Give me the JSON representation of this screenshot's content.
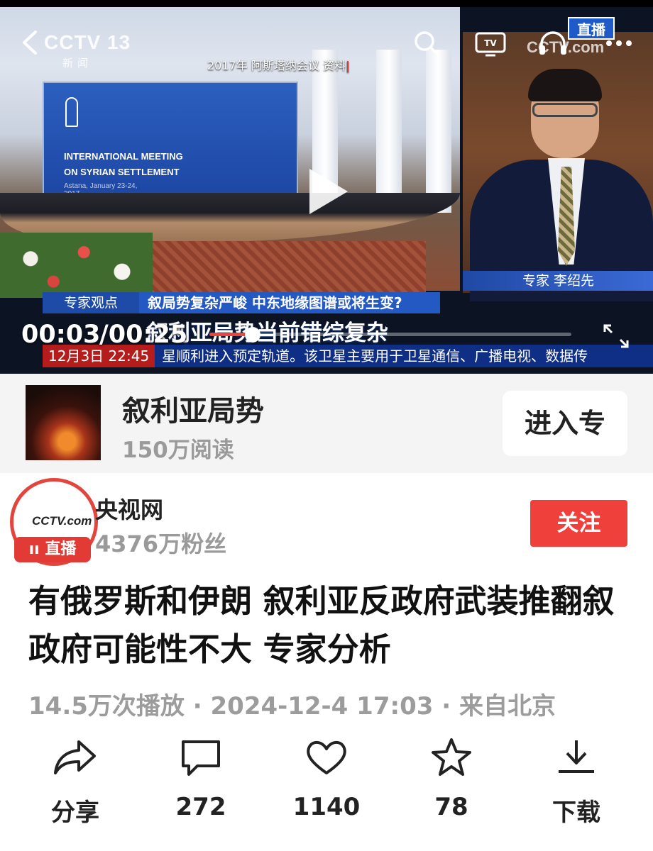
{
  "video": {
    "channel_logo": "CCTV 13",
    "channel_sub": "新闻",
    "source_year": "2017年",
    "source_event": "阿斯塔纳会议",
    "source_label": "资料",
    "banner_lines": [
      "INTERNATIONAL MEETING",
      "ON SYRIAN SETTLEMENT",
      "Astana, January 23-24, 2017"
    ],
    "cctv_com": "CCTV.com",
    "live_badge": "直播",
    "expert_caption": "专家 李绍先",
    "view_tag": "专家观点",
    "headline_bar": "叙局势复杂严峻 中东地缘图谱或将生变?",
    "caption_main": "叙利亚局势当前错综复杂",
    "ticker_time": "12月3日 22:45",
    "ticker_text": "星顺利进入预定轨道。该卫星主要用于卫星通信、广播电视、数据传",
    "time_current": "00:03",
    "time_total": "/00:25",
    "progress": 0.12,
    "icons": [
      "back-icon",
      "search-icon",
      "tv-icon",
      "headset-icon",
      "more-icon",
      "play-icon",
      "fullscreen-icon"
    ]
  },
  "topic": {
    "title": "叙利亚局势",
    "reads": "150万阅读",
    "enter_label": "进入专"
  },
  "author": {
    "avatar_logo": "CCTV.com",
    "avatar_logo_sub": "央视网",
    "live_tag": "直播",
    "name": "央视网",
    "fans": "4376万粉丝",
    "follow_label": "关注"
  },
  "article": {
    "title": "有俄罗斯和伊朗 叙利亚反政府武装推翻叙政府可能性不大 专家分析",
    "plays": "14.5万次播放",
    "date": "2024-12-4 17:03",
    "location": "来自北京"
  },
  "actions": {
    "share": "分享",
    "comments": "272",
    "likes": "1140",
    "favorites": "78",
    "download": "下载"
  },
  "colors": {
    "accent_red": "#f0403c",
    "cctv_blue": "#2459c4",
    "meta_gray": "#9c9c9c"
  }
}
